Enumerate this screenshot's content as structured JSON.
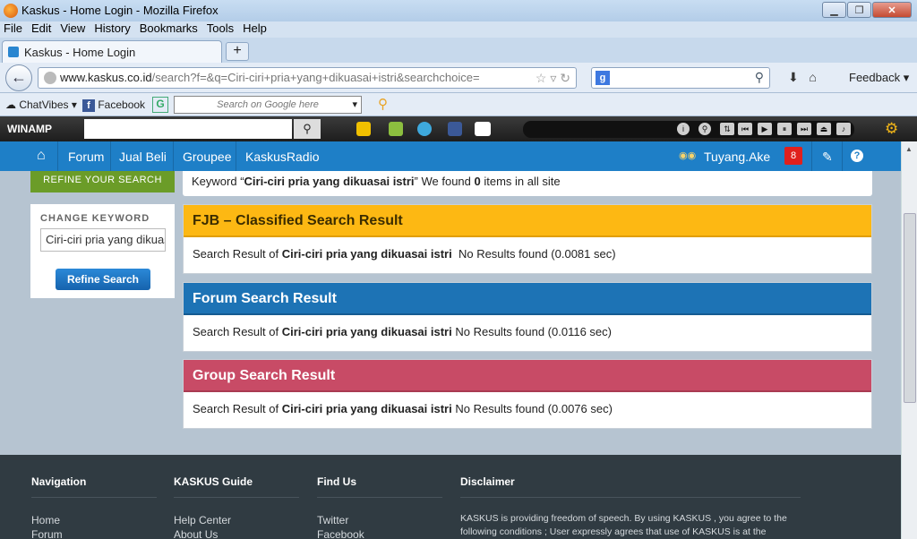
{
  "window": {
    "title": "Kaskus - Home Login - Mozilla Firefox"
  },
  "menu": [
    "File",
    "Edit",
    "View",
    "History",
    "Bookmarks",
    "Tools",
    "Help"
  ],
  "tab": {
    "title": "Kaskus - Home Login",
    "new_tab": "+"
  },
  "url": {
    "domain": "www.kaskus.co.id",
    "path": "/search?f=&q=Ciri-ciri+pria+yang+dikuasai+istri&searchchoice="
  },
  "toolbar": {
    "feedback": "Feedback"
  },
  "bookmarks": {
    "chatvibes": "ChatVibes",
    "facebook": "Facebook",
    "google_placeholder": "Search on Google here"
  },
  "winamp": {
    "logo": "WINAMP"
  },
  "kaskus_nav": {
    "items": [
      "Forum",
      "Jual Beli",
      "Groupee",
      "KaskusRadio"
    ],
    "user": "Tuyang.Ake",
    "notif": "8"
  },
  "sidebar": {
    "tag": "REFINE YOUR SEARCH",
    "label": "CHANGE KEYWORD",
    "keyword": "Ciri-ciri pria yang dikuasai istri",
    "button": "Refine Search"
  },
  "summary": {
    "pre": "Keyword “",
    "keyword": "Ciri-ciri pria yang dikuasai istri",
    "mid": "” We found ",
    "count": "0",
    "post": " items in all site"
  },
  "results": [
    {
      "title": "FJB – Classified Search Result",
      "color": "#fdb813",
      "text_color": "#3b2c00",
      "prefix": "Search Result of ",
      "keyword": "Ciri-ciri pria yang dikuasai istri",
      "suffix": "  No Results found (0.0081 sec)"
    },
    {
      "title": "Forum Search Result",
      "color": "#1d73b5",
      "text_color": "#ffffff",
      "prefix": "Search Result of ",
      "keyword": "Ciri-ciri pria yang dikuasai istri",
      "suffix": " No Results found (0.0116 sec)"
    },
    {
      "title": "Group Search Result",
      "color": "#c84b66",
      "text_color": "#ffffff",
      "prefix": "Search Result of ",
      "keyword": "Ciri-ciri pria yang dikuasai istri",
      "suffix": " No Results found (0.0076 sec)"
    }
  ],
  "footer": {
    "navigation": {
      "title": "Navigation",
      "links": [
        "Home",
        "Forum"
      ]
    },
    "guide": {
      "title": "KASKUS Guide",
      "links": [
        "Help Center",
        "About Us"
      ]
    },
    "findus": {
      "title": "Find Us",
      "links": [
        "Twitter",
        "Facebook"
      ]
    },
    "disclaimer": {
      "title": "Disclaimer",
      "text": "KASKUS is providing freedom of speech. By using KASKUS , you agree to the following conditions ; User expressly agrees that use of KASKUS is at the"
    }
  }
}
